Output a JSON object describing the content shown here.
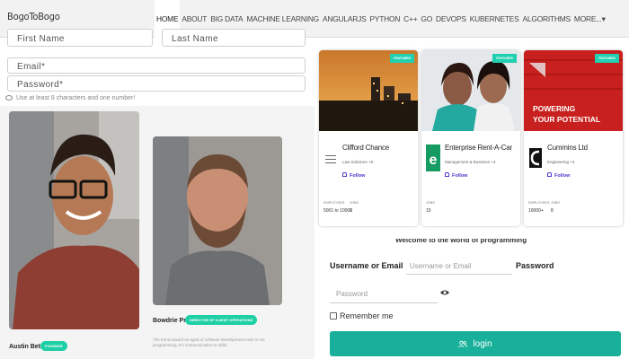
{
  "nav": {
    "brand": "BogoToBogo",
    "items": [
      "HOME",
      "ABOUT",
      "BIG DATA",
      "MACHINE LEARNING",
      "ANGULARJS",
      "PYTHON",
      "C++",
      "GO",
      "DEVOPS",
      "KUBERNETES",
      "ALGORITHMS",
      "MORE...▾"
    ]
  },
  "form": {
    "first_name": "First Name",
    "last_name": "Last Name",
    "email": "Email*",
    "password": "Password*",
    "hint": "Use at least 8 characters and one number!"
  },
  "people": [
    {
      "name": "Austin Betzer",
      "badge": "FOUNDER"
    },
    {
      "name": "Bowdrie Price",
      "badge": "DIRECTOR OF CLIENT OPERATIONS",
      "bio": "The trend toward an aged of software development tools is not programming. It's communication to skills."
    }
  ],
  "cards": [
    {
      "tag": "FEATURED",
      "name": "Clifford Chance",
      "sub": "Law Solicitors +0",
      "follow": "Follow",
      "stat1_label": "EMPLOYEES",
      "stat1_value": "5001 to 10000",
      "stat2_label": "JOBS",
      "stat2_value": "1"
    },
    {
      "tag": "FEATURED",
      "name": "Enterprise Rent-A-Car",
      "sub": "Management & Business +2",
      "follow": "Follow",
      "stat1_label": "JOBS",
      "stat1_value": "15"
    },
    {
      "tag": "FEATURED",
      "name": "Cummins Ltd",
      "sub": "Engineering +3",
      "follow": "Follow",
      "banner": "POWERING YOUR POTENTIAL",
      "stat1_label": "EMPLOYEES",
      "stat1_value": "10000+",
      "stat2_label": "JOBS",
      "stat2_value": "8"
    }
  ],
  "login": {
    "welcome": "Welcome to the world of programming",
    "username_label": "Username or Email",
    "username_placeholder": "Username or Email",
    "password_label": "Password",
    "password_placeholder": "Password",
    "remember": "Remember me",
    "button": "login"
  },
  "colors": {
    "accent": "#18b09a",
    "badge": "#1fcfa6",
    "follow": "#5533cc"
  }
}
